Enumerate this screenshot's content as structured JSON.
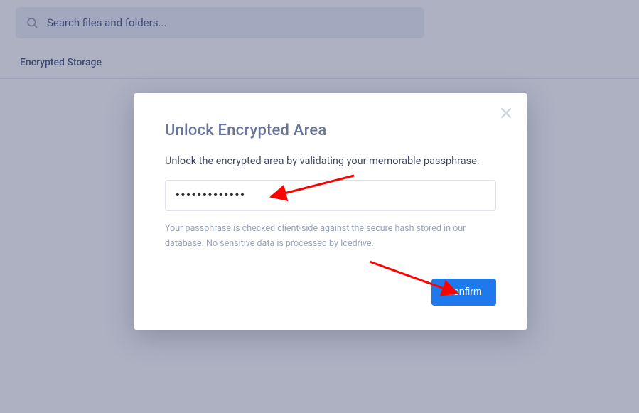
{
  "search": {
    "placeholder": "Search files and folders..."
  },
  "breadcrumb": "Encrypted Storage",
  "modal": {
    "title": "Unlock Encrypted Area",
    "lead": "Unlock the encrypted area by validating your memorable passphrase.",
    "passphrase_value": "•••••••••••••",
    "hint": "Your passphrase is checked client-side against the secure hash stored in our database. No sensitive data is processed by Icedrive.",
    "confirm_label": "Confirm"
  }
}
